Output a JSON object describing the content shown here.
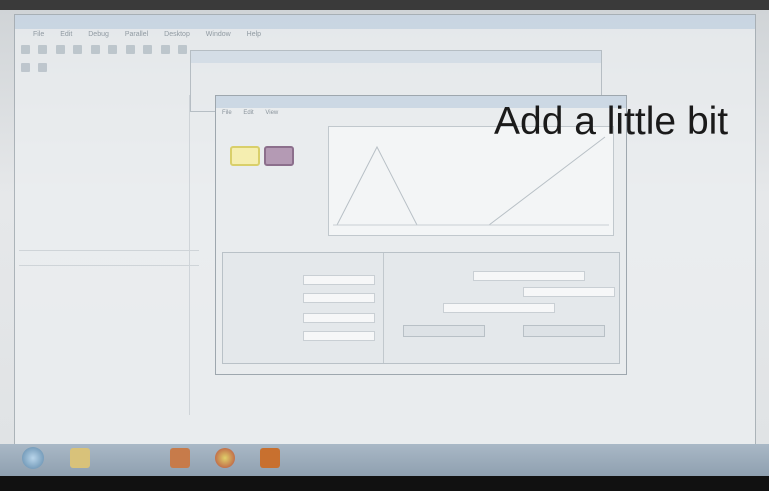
{
  "overlay": {
    "text": "Add a little bit"
  },
  "app": {
    "menu_items": [
      "File",
      "Edit",
      "Debug",
      "Parallel",
      "Desktop",
      "Window",
      "Help"
    ]
  },
  "fis_window": {
    "menu_items": [
      "File",
      "Edit",
      "View"
    ]
  },
  "taskbar": {
    "icons": [
      "start-orb",
      "explorer-icon",
      "media-icon",
      "chrome-icon",
      "matlab-icon"
    ]
  }
}
